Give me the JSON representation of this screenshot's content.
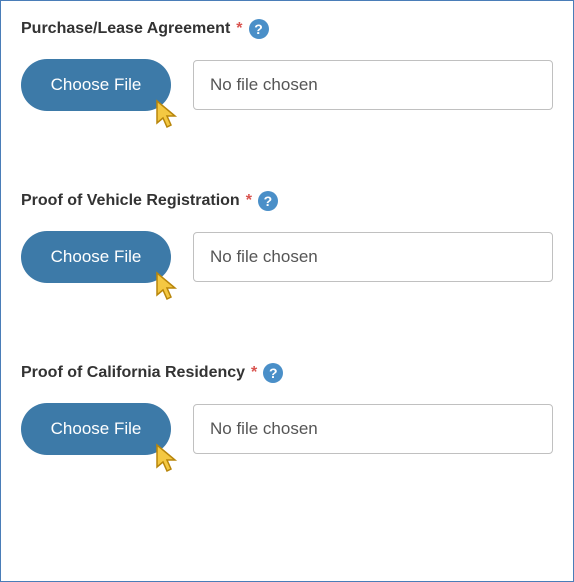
{
  "fields": [
    {
      "label": "Purchase/Lease Agreement",
      "required": "*",
      "button": "Choose File",
      "filename": "No file chosen",
      "name_slug": "purchase-lease-agreement"
    },
    {
      "label": "Proof of Vehicle Registration",
      "required": "*",
      "button": "Choose File",
      "filename": "No file chosen",
      "name_slug": "vehicle-registration"
    },
    {
      "label": "Proof of California Residency",
      "required": "*",
      "button": "Choose File",
      "filename": "No file chosen",
      "name_slug": "california-residency"
    }
  ],
  "help_glyph": "?"
}
